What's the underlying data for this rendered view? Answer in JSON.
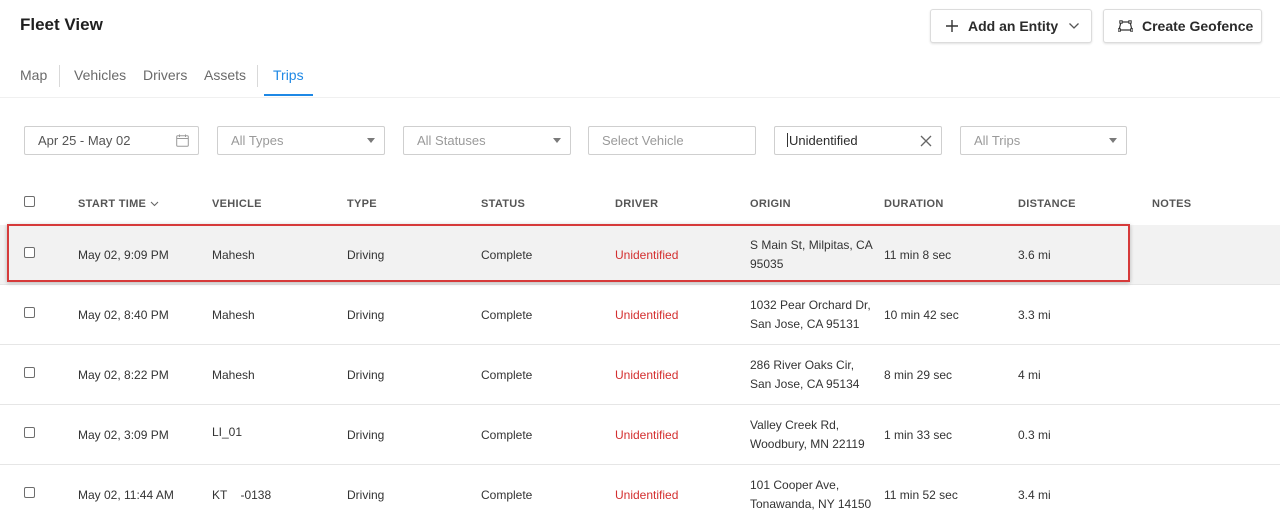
{
  "header": {
    "title": "Fleet View",
    "add_entity_label": "Add an Entity",
    "create_geofence_label": "Create Geofence"
  },
  "tabs": [
    {
      "label": "Map"
    },
    {
      "label": "Vehicles"
    },
    {
      "label": "Drivers"
    },
    {
      "label": "Assets"
    },
    {
      "label": "Trips",
      "active": true
    }
  ],
  "filters": {
    "date_range": "Apr 25 - May 02",
    "types_placeholder": "All Types",
    "statuses_placeholder": "All Statuses",
    "vehicle_placeholder": "Select Vehicle",
    "driver_value": "Unidentified",
    "trips_placeholder": "All Trips"
  },
  "table": {
    "columns": [
      "START TIME",
      "VEHICLE",
      "TYPE",
      "STATUS",
      "DRIVER",
      "ORIGIN",
      "DURATION",
      "DISTANCE",
      "NOTES"
    ],
    "rows": [
      {
        "start": "May 02, 9:09 PM",
        "vehicle": "Mahesh",
        "type": "Driving",
        "status": "Complete",
        "driver": "Unidentified",
        "origin": "S Main St, Milpitas, CA 95035",
        "duration": "11 min 8 sec",
        "distance": "3.6 mi",
        "notes": ""
      },
      {
        "start": "May 02, 8:40 PM",
        "vehicle": "Mahesh",
        "type": "Driving",
        "status": "Complete",
        "driver": "Unidentified",
        "origin": "1032 Pear Orchard Dr, San Jose, CA 95131",
        "duration": "10 min 42 sec",
        "distance": "3.3 mi",
        "notes": ""
      },
      {
        "start": "May 02, 8:22 PM",
        "vehicle": "Mahesh",
        "type": "Driving",
        "status": "Complete",
        "driver": "Unidentified",
        "origin": "286 River Oaks Cir, San Jose, CA 95134",
        "duration": "8 min 29 sec",
        "distance": "4 mi",
        "notes": ""
      },
      {
        "start": "May 02, 3:09 PM",
        "vehicle": "LI_01",
        "type": "Driving",
        "status": "Complete",
        "driver": "Unidentified",
        "origin": "Valley Creek Rd, Woodbury, MN 22119",
        "duration": "1 min 33 sec",
        "distance": "0.3 mi",
        "notes": ""
      },
      {
        "start": "May 02, 11:44 AM",
        "vehicle": "KT    -0138",
        "type": "Driving",
        "status": "Complete",
        "driver": "Unidentified",
        "origin": "101 Cooper Ave, Tonawanda, NY 14150",
        "duration": "11 min 52 sec",
        "distance": "3.4 mi",
        "notes": ""
      }
    ]
  },
  "colors": {
    "accent": "#1e88e5",
    "driver_text": "#d32f2f",
    "highlight_border": "#d63a3a",
    "selected_row_bg": "#f2f2f2"
  }
}
